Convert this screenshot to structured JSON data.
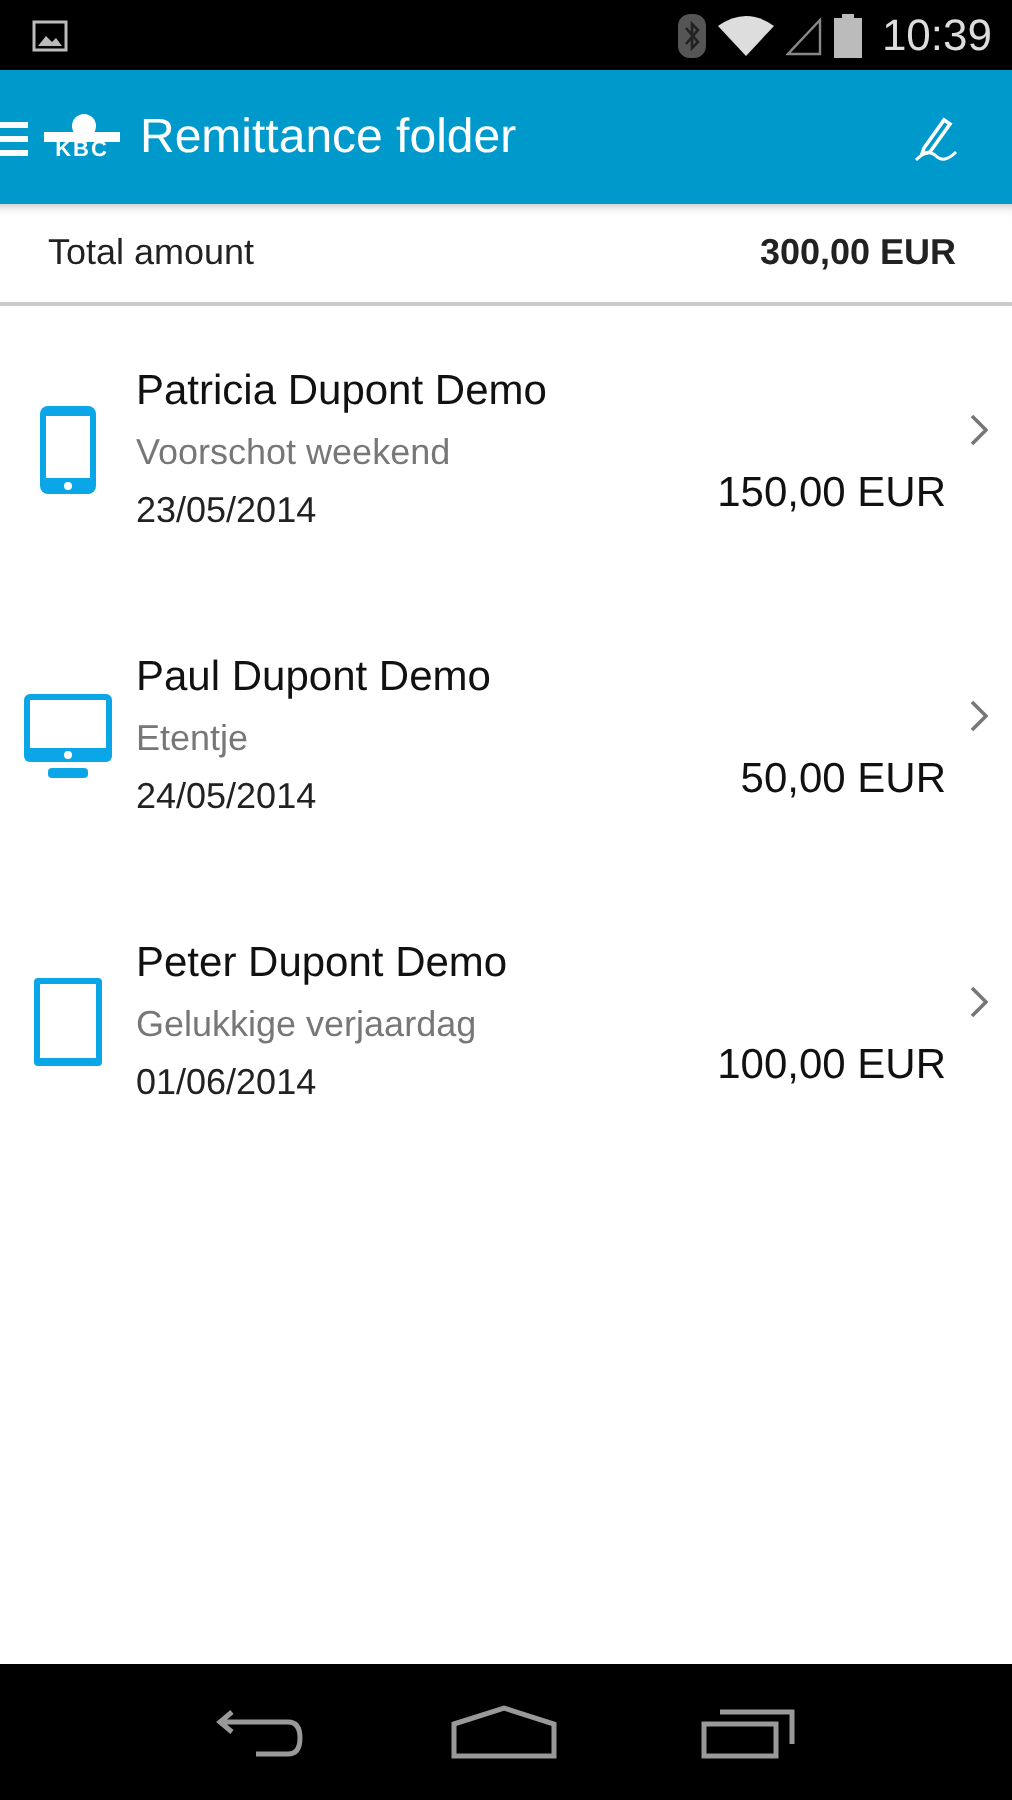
{
  "status_bar": {
    "time": "10:39"
  },
  "app_bar": {
    "logo_text": "KBC",
    "title": "Remittance folder"
  },
  "total": {
    "label": "Total amount",
    "amount": "300,00 EUR"
  },
  "remittances": [
    {
      "name": "Patricia Dupont Demo",
      "note": "Voorschot weekend",
      "date": "23/05/2014",
      "amount": "150,00 EUR",
      "kind": "phone"
    },
    {
      "name": "Paul Dupont Demo",
      "note": "Etentje",
      "date": "24/05/2014",
      "amount": "50,00 EUR",
      "kind": "desktop"
    },
    {
      "name": "Peter Dupont Demo",
      "note": "Gelukkige verjaardag",
      "date": "01/06/2014",
      "amount": "100,00 EUR",
      "kind": "tablet"
    }
  ]
}
